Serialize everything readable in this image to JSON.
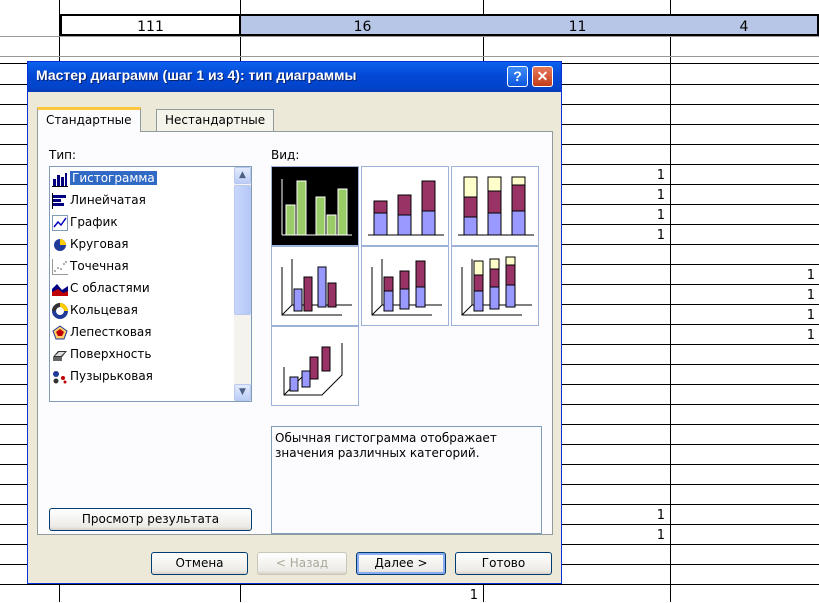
{
  "sheet": {
    "header_values": [
      "111",
      "16",
      "11",
      "4"
    ],
    "numbers_col_c": [
      "1",
      "1",
      "1",
      "1",
      "1",
      "1"
    ],
    "numbers_col_e": [
      "1",
      "1",
      "1",
      "1"
    ],
    "bottom_number": "1"
  },
  "dialog": {
    "title": "Мастер диаграмм (шаг 1 из 4): тип диаграммы",
    "help_glyph": "?",
    "close_glyph": "✕",
    "tabs": [
      {
        "label": "Стандартные",
        "selected": true
      },
      {
        "label": "Нестандартные",
        "selected": false
      }
    ],
    "type_label": "Тип:",
    "view_label": "Вид:",
    "chart_types": [
      {
        "label": "Гистограмма",
        "icon": "column-chart-icon",
        "selected": true
      },
      {
        "label": "Линейчатая",
        "icon": "bar-chart-icon"
      },
      {
        "label": "График",
        "icon": "line-chart-icon"
      },
      {
        "label": "Круговая",
        "icon": "pie-chart-icon"
      },
      {
        "label": "Точечная",
        "icon": "scatter-chart-icon"
      },
      {
        "label": "С областями",
        "icon": "area-chart-icon"
      },
      {
        "label": "Кольцевая",
        "icon": "doughnut-chart-icon"
      },
      {
        "label": "Лепестковая",
        "icon": "radar-chart-icon"
      },
      {
        "label": "Поверхность",
        "icon": "surface-chart-icon"
      },
      {
        "label": "Пузырьковая",
        "icon": "bubble-chart-icon"
      }
    ],
    "description": "Обычная гистограмма отображает значения различных категорий.",
    "preview_button": "Просмотр результата",
    "buttons": {
      "cancel": "Отмена",
      "back": "< Назад",
      "next": "Далее >",
      "finish": "Готово"
    },
    "colors": {
      "titlebar": "#0348d7",
      "selection": "#316ac5",
      "bar_purple": "#993366",
      "bar_blue": "#9999ff",
      "bar_yellow": "#ffffcc",
      "bar_green": "#99cc66"
    }
  }
}
